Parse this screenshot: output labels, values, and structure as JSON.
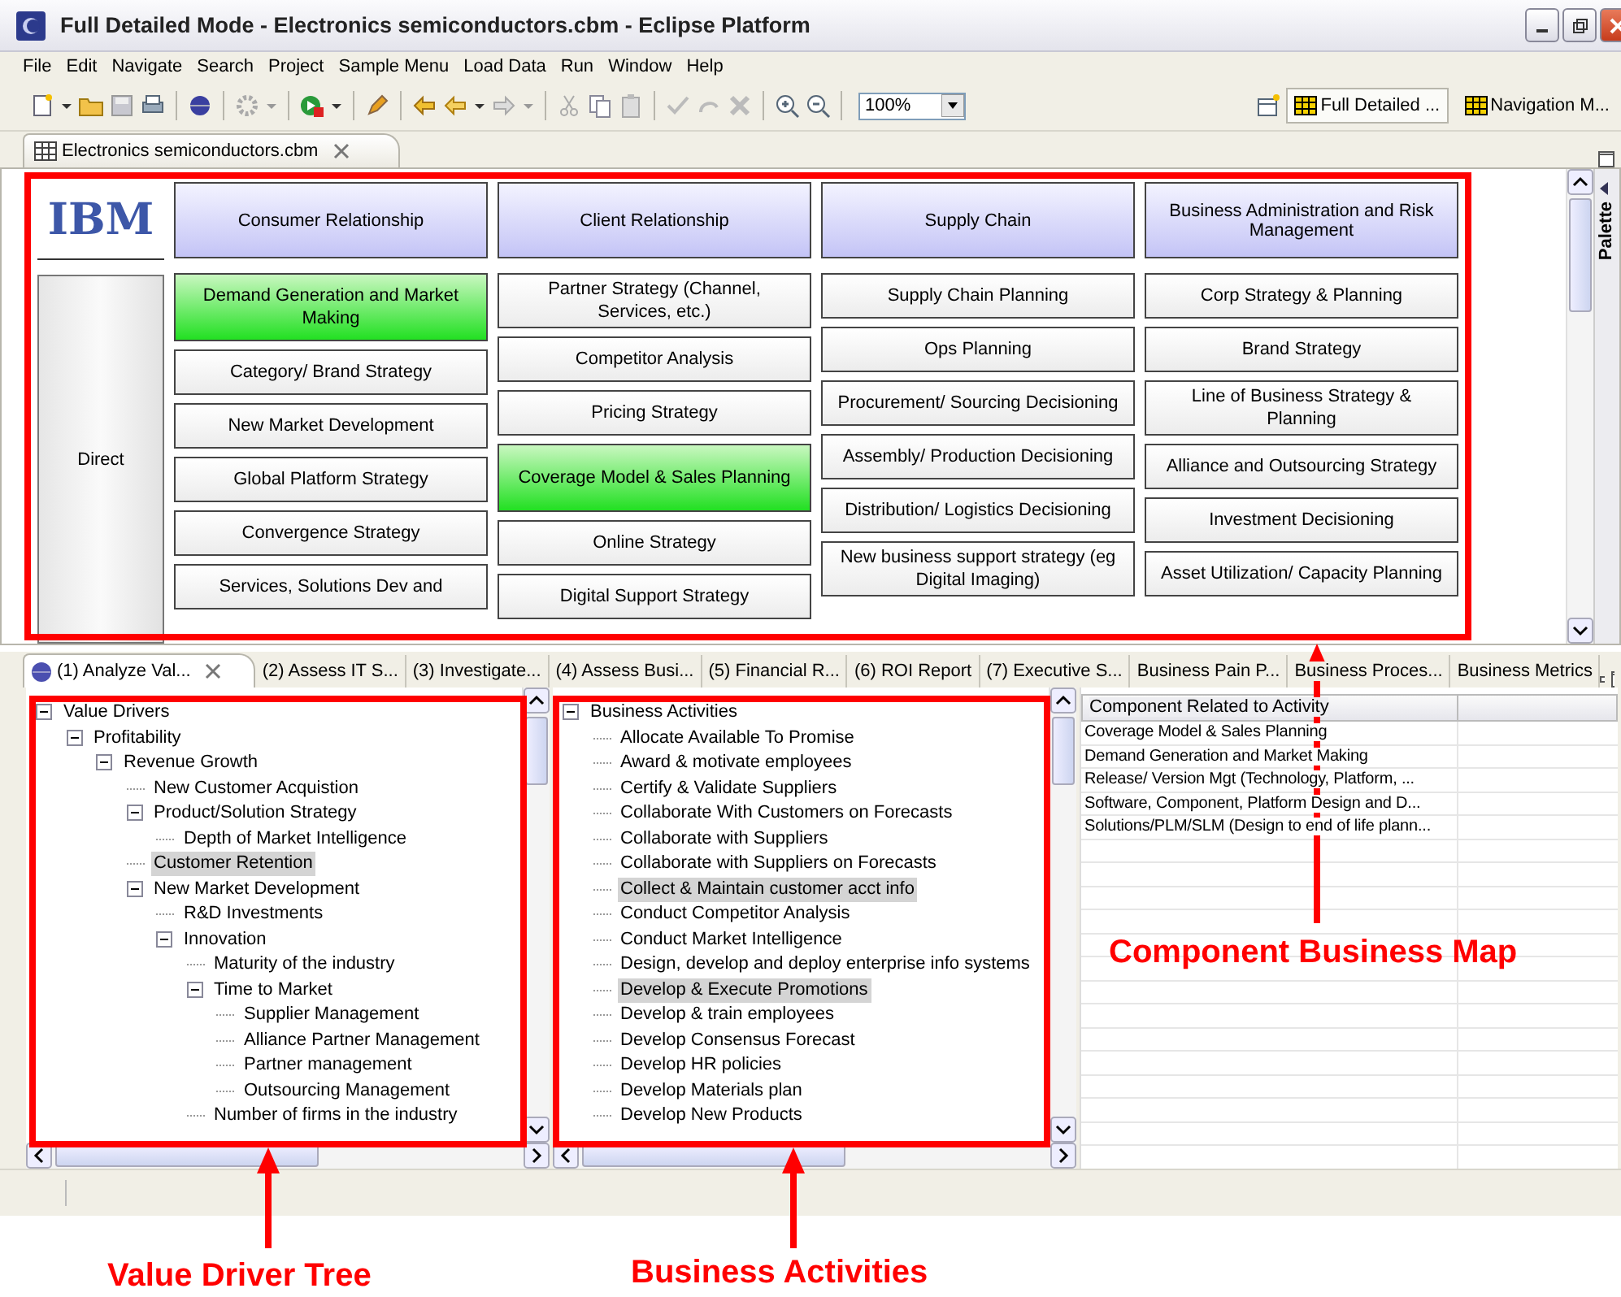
{
  "window": {
    "title": "Full Detailed Mode - Electronics semiconductors.cbm - Eclipse Platform"
  },
  "menu": [
    "File",
    "Edit",
    "Navigate",
    "Search",
    "Project",
    "Sample Menu",
    "Load Data",
    "Run",
    "Window",
    "Help"
  ],
  "toolbar": {
    "zoom": "100%",
    "perspectives": [
      {
        "label": "Full Detailed ...",
        "selected": true
      },
      {
        "label": "Navigation M...",
        "selected": false
      }
    ]
  },
  "editor_tab": {
    "label": "Electronics semiconductors.cbm"
  },
  "map": {
    "logo": "IBM",
    "row_label": "Direct",
    "columns": [
      {
        "header": "Consumer Relationship",
        "cells": [
          {
            "label": "Demand Generation and Market Making",
            "highlighted": true
          },
          {
            "label": "Category/ Brand Strategy",
            "highlighted": false
          },
          {
            "label": "New Market Development",
            "highlighted": false
          },
          {
            "label": "Global Platform Strategy",
            "highlighted": false
          },
          {
            "label": "Convergence Strategy",
            "highlighted": false
          },
          {
            "label": "Services, Solutions Dev and",
            "highlighted": false
          }
        ]
      },
      {
        "header": "Client Relationship",
        "cells": [
          {
            "label": "Partner Strategy (Channel, Services, etc.)",
            "highlighted": false
          },
          {
            "label": "Competitor Analysis",
            "highlighted": false
          },
          {
            "label": "Pricing Strategy",
            "highlighted": false
          },
          {
            "label": "Coverage Model & Sales Planning",
            "highlighted": true
          },
          {
            "label": "Online Strategy",
            "highlighted": false
          },
          {
            "label": "Digital Support Strategy",
            "highlighted": false
          }
        ]
      },
      {
        "header": "Supply Chain",
        "cells": [
          {
            "label": "Supply Chain Planning",
            "highlighted": false
          },
          {
            "label": "Ops Planning",
            "highlighted": false
          },
          {
            "label": "Procurement/ Sourcing Decisioning",
            "highlighted": false
          },
          {
            "label": "Assembly/ Production Decisioning",
            "highlighted": false
          },
          {
            "label": "Distribution/ Logistics Decisioning",
            "highlighted": false
          },
          {
            "label": "New business support strategy (eg Digital Imaging)",
            "highlighted": false
          }
        ]
      },
      {
        "header": "Business Administration and Risk Management",
        "cells": [
          {
            "label": "Corp Strategy & Planning",
            "highlighted": false
          },
          {
            "label": "Brand Strategy",
            "highlighted": false
          },
          {
            "label": "Line of Business Strategy & Planning",
            "highlighted": false
          },
          {
            "label": "Alliance and Outsourcing Strategy",
            "highlighted": false
          },
          {
            "label": "Investment Decisioning",
            "highlighted": false
          },
          {
            "label": "Asset Utilization/ Capacity Planning",
            "highlighted": false
          }
        ]
      }
    ]
  },
  "palette": {
    "label": "Palette"
  },
  "view_tabs": [
    {
      "label": "(1) Analyze Val...",
      "selected": true
    },
    {
      "label": "(2) Assess IT S...",
      "selected": false
    },
    {
      "label": "(3) Investigate...",
      "selected": false
    },
    {
      "label": "(4) Assess Busi...",
      "selected": false
    },
    {
      "label": "(5) Financial R...",
      "selected": false
    },
    {
      "label": "(6) ROI Report",
      "selected": false
    },
    {
      "label": "(7) Executive S...",
      "selected": false
    },
    {
      "label": "Business Pain P...",
      "selected": false
    },
    {
      "label": "Business Proces...",
      "selected": false
    },
    {
      "label": "Business Metrics",
      "selected": false
    }
  ],
  "value_tree": [
    {
      "label": "Value Drivers",
      "expanded": true,
      "selected": false,
      "children": [
        {
          "label": "Profitability",
          "expanded": true,
          "selected": false,
          "children": [
            {
              "label": "Revenue Growth",
              "expanded": true,
              "selected": false,
              "children": [
                {
                  "label": "New Customer Acquistion",
                  "selected": false
                },
                {
                  "label": "Product/Solution Strategy",
                  "expanded": true,
                  "selected": false,
                  "children": [
                    {
                      "label": "Depth of Market Intelligence",
                      "selected": false
                    }
                  ]
                },
                {
                  "label": "Customer Retention",
                  "selected": true
                },
                {
                  "label": "New Market Development",
                  "expanded": true,
                  "selected": false,
                  "children": [
                    {
                      "label": "R&D Investments",
                      "selected": false
                    },
                    {
                      "label": "Innovation",
                      "expanded": true,
                      "selected": false,
                      "children": [
                        {
                          "label": "Maturity of the industry",
                          "selected": false
                        },
                        {
                          "label": "Time to Market",
                          "expanded": true,
                          "selected": false,
                          "children": [
                            {
                              "label": "Supplier Management",
                              "selected": false
                            },
                            {
                              "label": "Alliance Partner Management",
                              "selected": false
                            },
                            {
                              "label": "Partner management",
                              "selected": false
                            },
                            {
                              "label": "Outsourcing Management",
                              "selected": false
                            }
                          ]
                        },
                        {
                          "label": "Number of firms in the industry",
                          "selected": false
                        }
                      ]
                    }
                  ]
                }
              ]
            }
          ]
        }
      ]
    }
  ],
  "activities_tree": [
    {
      "label": "Business Activities",
      "expanded": true,
      "selected": false,
      "children": [
        {
          "label": "Allocate Available To Promise",
          "selected": false
        },
        {
          "label": "Award & motivate employees",
          "selected": false
        },
        {
          "label": "Certify & Validate Suppliers",
          "selected": false
        },
        {
          "label": "Collaborate With Customers on Forecasts",
          "selected": false
        },
        {
          "label": "Collaborate with Suppliers",
          "selected": false
        },
        {
          "label": "Collaborate with Suppliers on Forecasts",
          "selected": false
        },
        {
          "label": "Collect & Maintain customer acct info",
          "selected": true
        },
        {
          "label": "Conduct Competitor Analysis",
          "selected": false
        },
        {
          "label": "Conduct Market Intelligence",
          "selected": false
        },
        {
          "label": "Design, develop and deploy enterprise info systems",
          "selected": false
        },
        {
          "label": "Develop & Execute Promotions",
          "selected": true
        },
        {
          "label": "Develop & train employees",
          "selected": false
        },
        {
          "label": "Develop Consensus Forecast",
          "selected": false
        },
        {
          "label": "Develop HR policies",
          "selected": false
        },
        {
          "label": "Develop Materials plan",
          "selected": false
        },
        {
          "label": "Develop New Products",
          "selected": false
        }
      ]
    }
  ],
  "table": {
    "columns": [
      "Component Related to Activity"
    ],
    "rows": [
      "Coverage Model & Sales Planning",
      "Demand Generation and Market Making",
      "Release/ Version Mgt (Technology, Platform, ...",
      "Software, Component, Platform Design and D...",
      "Solutions/PLM/SLM (Design to end of life plann..."
    ]
  },
  "annotations": [
    {
      "label": "Component Business Map"
    },
    {
      "label": "Value Driver Tree"
    },
    {
      "label": "Business Activities"
    }
  ]
}
